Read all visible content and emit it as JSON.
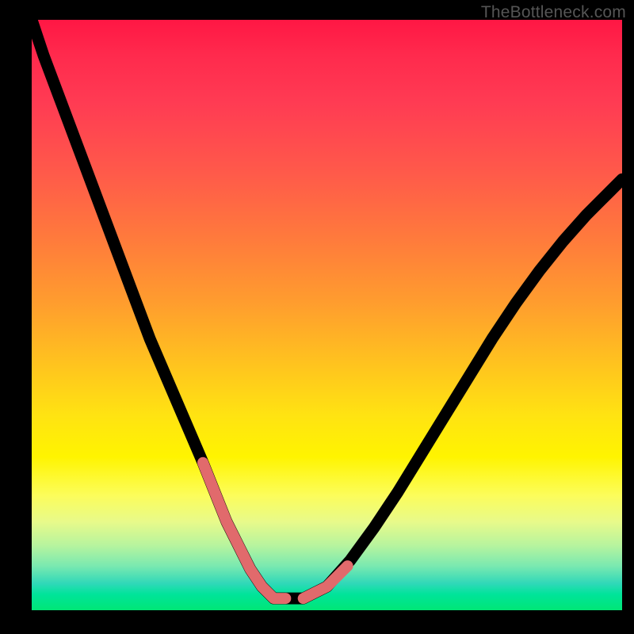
{
  "watermark": "TheBottleneck.com",
  "chart_data": {
    "type": "line",
    "title": "",
    "xlabel": "",
    "ylabel": "",
    "xlim": [
      0,
      100
    ],
    "ylim": [
      0,
      100
    ],
    "grid": false,
    "legend": false,
    "series": [
      {
        "name": "bottleneck-curve",
        "x": [
          0,
          2,
          5,
          8,
          11,
          14,
          17,
          20,
          23,
          26,
          29,
          31,
          33,
          35,
          37,
          39,
          41,
          43,
          46,
          50,
          54,
          58,
          62,
          66,
          70,
          74,
          78,
          82,
          86,
          90,
          94,
          98,
          100
        ],
        "y": [
          100,
          94,
          86,
          78,
          70,
          62,
          54,
          46,
          39,
          32,
          25,
          20,
          15,
          11,
          7,
          4,
          2,
          2,
          2,
          4,
          8.5,
          14,
          20,
          26.5,
          33,
          39.5,
          46,
          52,
          57.5,
          62.5,
          67,
          71,
          73
        ]
      }
    ],
    "highlight_segments": [
      {
        "name": "descending-tail",
        "x": [
          29,
          31,
          33,
          35,
          37,
          39,
          41,
          43
        ],
        "y": [
          25,
          20,
          15,
          11,
          7,
          4,
          2,
          2
        ]
      },
      {
        "name": "ascending-tail",
        "x": [
          46,
          48,
          50,
          52,
          53.5
        ],
        "y": [
          2,
          3,
          4,
          6,
          7.5
        ]
      }
    ],
    "background_gradient": {
      "top": "#ff1744",
      "mid": "#fff400",
      "bottom": "#00e676"
    }
  }
}
